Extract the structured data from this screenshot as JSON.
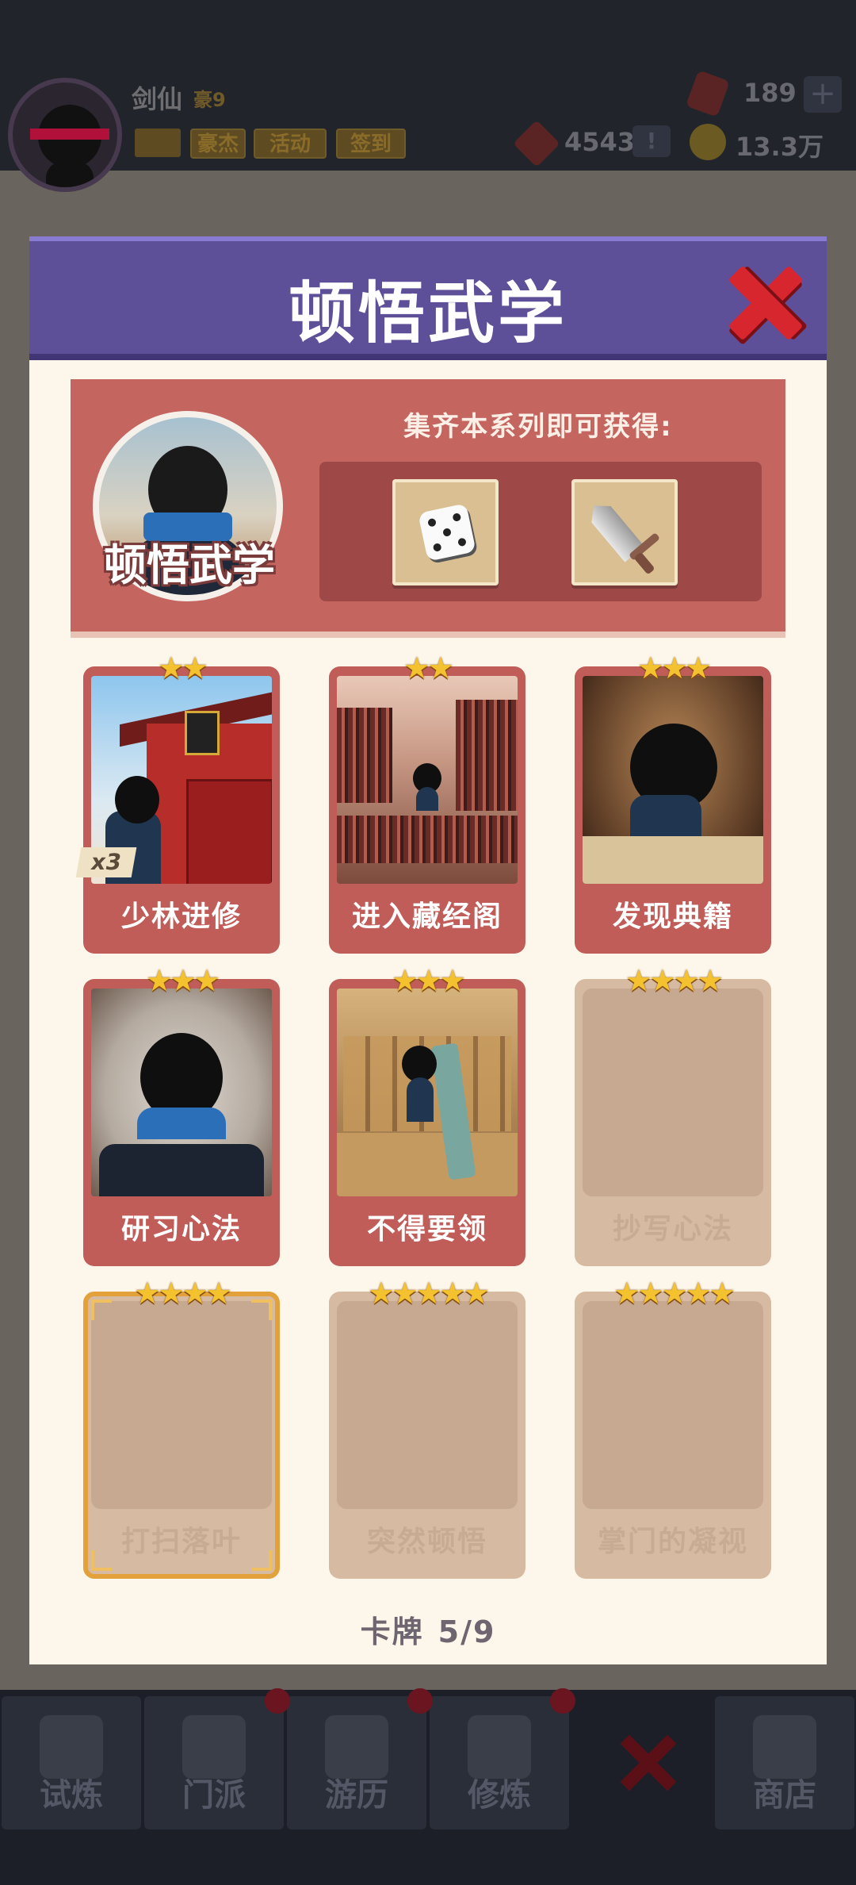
{
  "background": {
    "player": {
      "name": "剑仙",
      "vip": "豪9"
    },
    "top_buttons": [
      "豪杰",
      "活动",
      "签到"
    ],
    "resources": {
      "gems": "189",
      "tokens": "4543",
      "coins": "13.3万"
    },
    "plus_label": "+",
    "alert_label": "!",
    "nav": [
      "试炼",
      "门派",
      "游历",
      "修炼",
      "商店"
    ]
  },
  "modal": {
    "title": "顿悟武学",
    "series": {
      "name": "顿悟武学",
      "reward_caption": "集齐本系列即可获得:",
      "rewards": [
        "dice-icon",
        "sword-icon"
      ]
    },
    "cards": [
      {
        "name": "少林进修",
        "stars": "★★",
        "owned": true,
        "count": "x3"
      },
      {
        "name": "进入藏经阁",
        "stars": "★★",
        "owned": true
      },
      {
        "name": "发现典籍",
        "stars": "★★★",
        "owned": true
      },
      {
        "name": "研习心法",
        "stars": "★★★",
        "owned": true
      },
      {
        "name": "不得要领",
        "stars": "★★★",
        "owned": true
      },
      {
        "name": "抄写心法",
        "stars": "★★★★",
        "owned": false
      },
      {
        "name": "打扫落叶",
        "stars": "★★★★",
        "owned": false,
        "highlighted": true
      },
      {
        "name": "突然顿悟",
        "stars": "★★★★★",
        "owned": false
      },
      {
        "name": "掌门的凝视",
        "stars": "★★★★★",
        "owned": false
      }
    ],
    "counter": {
      "label": "卡牌",
      "value": "5/9"
    }
  },
  "colors": {
    "header": "#5e4f99",
    "panel": "#c46560",
    "owned_card": "#c05d59",
    "empty_card": "#d6baa2",
    "highlight_border": "#e2a13a",
    "close": "#d8262f"
  }
}
